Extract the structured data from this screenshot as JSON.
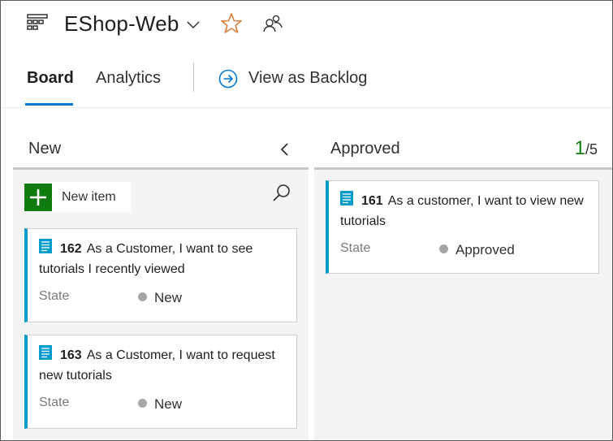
{
  "header": {
    "project_name": "EShop-Web"
  },
  "tabs": {
    "board": "Board",
    "analytics": "Analytics",
    "backlog": "View as Backlog"
  },
  "columns": {
    "new": {
      "title": "New",
      "new_item_label": "New item",
      "cards": [
        {
          "id": "162",
          "title": "As a Customer, I want to see tutorials I recently viewed",
          "state_label": "State",
          "state": "New"
        },
        {
          "id": "163",
          "title": "As a Customer, I want to request new tutorials",
          "state_label": "State",
          "state": "New"
        }
      ]
    },
    "approved": {
      "title": "Approved",
      "count": "1",
      "limit": "/5",
      "cards": [
        {
          "id": "161",
          "title": "As a customer, I want to view new tutorials",
          "state_label": "State",
          "state": "Approved"
        }
      ]
    }
  },
  "colors": {
    "accent": "#0078d4",
    "card_bar": "#009ccc",
    "add_button": "#107c10",
    "count_ok": "#107c10",
    "favorite_star": "#e07b39",
    "state_dot": "#a6a6a6"
  },
  "icons": [
    "board-grid-icon",
    "chevron-down-icon",
    "star-icon",
    "team-members-icon",
    "arrow-right-circle-icon",
    "chevron-left-icon",
    "plus-icon",
    "search-icon",
    "user-story-icon"
  ]
}
